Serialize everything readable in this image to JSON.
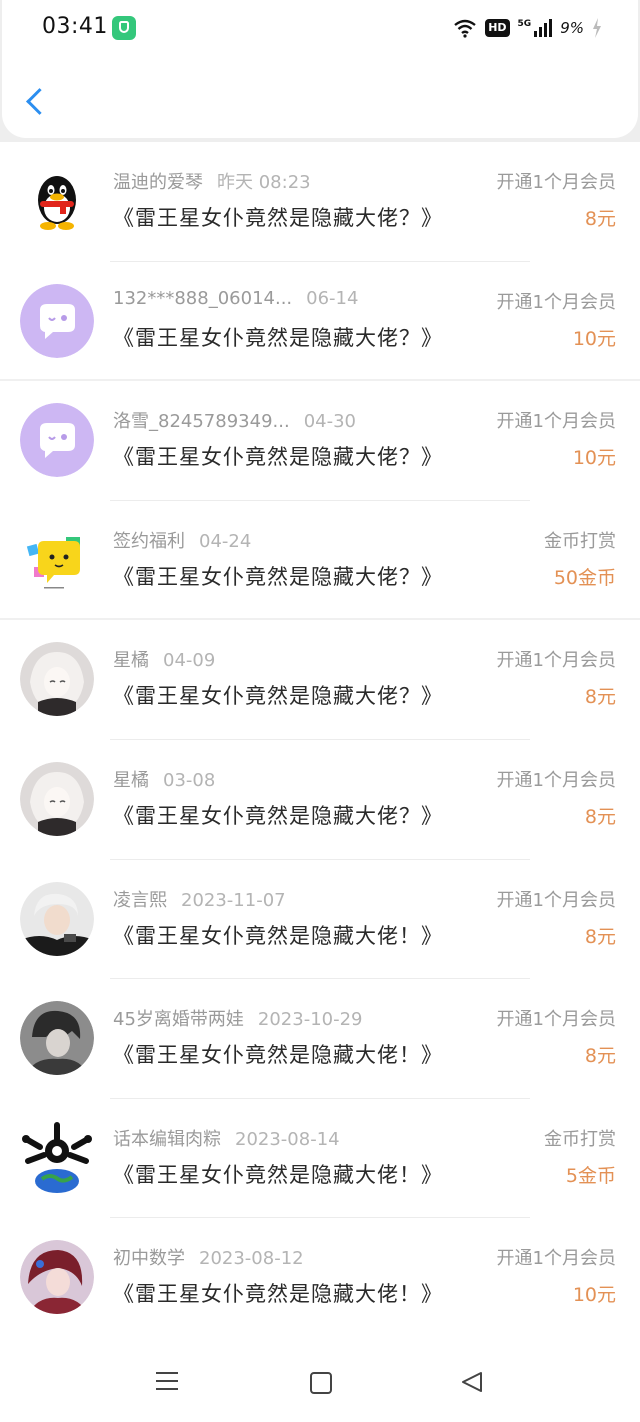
{
  "status_bar": {
    "time": "03:41",
    "hd_label": "HD",
    "network_label": "5G",
    "battery": "9%"
  },
  "header": {
    "back_icon": "chevron-left-icon",
    "accent": "#2b8ef0"
  },
  "colors": {
    "amount": "#e39155",
    "meta": "#9a9a9a",
    "title": "#2a2a2a"
  },
  "records": [
    {
      "name": "温迪的爱琴",
      "date": "昨天 08:23",
      "title": "《雷王星女仆竟然是隐藏大佬？》",
      "type": "开通1个月会员",
      "amount": "8元",
      "avatar": "qq-penguin-avatar"
    },
    {
      "name": "132***888_06014...",
      "date": "06-14",
      "title": "《雷王星女仆竟然是隐藏大佬？》",
      "type": "开通1个月会员",
      "amount": "10元",
      "avatar": "default-chat-avatar"
    },
    {
      "name": "洛雪_8245789349...",
      "date": "04-30",
      "title": "《雷王星女仆竟然是隐藏大佬？》",
      "type": "开通1个月会员",
      "amount": "10元",
      "avatar": "default-chat-avatar"
    },
    {
      "name": "签约福利",
      "date": "04-24",
      "title": "《雷王星女仆竟然是隐藏大佬？》",
      "type": "金币打赏",
      "amount": "50金币",
      "avatar": "yellow-chat-avatar"
    },
    {
      "name": "星橘",
      "date": "04-09",
      "title": "《雷王星女仆竟然是隐藏大佬？》",
      "type": "开通1个月会员",
      "amount": "8元",
      "avatar": "anime-girl-avatar"
    },
    {
      "name": "星橘",
      "date": "03-08",
      "title": "《雷王星女仆竟然是隐藏大佬？》",
      "type": "开通1个月会员",
      "amount": "8元",
      "avatar": "anime-girl-avatar"
    },
    {
      "name": "凌言熙",
      "date": "2023-11-07",
      "title": "《雷王星女仆竟然是隐藏大佬！》",
      "type": "开通1个月会员",
      "amount": "8元",
      "avatar": "photo-avatar"
    },
    {
      "name": "45岁离婚带两娃",
      "date": "2023-10-29",
      "title": "《雷王星女仆竟然是隐藏大佬！》",
      "type": "开通1个月会员",
      "amount": "8元",
      "avatar": "anime-boy-avatar"
    },
    {
      "name": "话本编辑肉粽",
      "date": "2023-08-14",
      "title": "《雷王星女仆竟然是隐藏大佬！》",
      "type": "金币打赏",
      "amount": "5金币",
      "avatar": "earth-avatar"
    },
    {
      "name": "初中数学",
      "date": "2023-08-12",
      "title": "《雷王星女仆竟然是隐藏大佬！》",
      "type": "开通1个月会员",
      "amount": "10元",
      "avatar": "anime-girl-red-avatar"
    }
  ],
  "nav": {
    "menu_icon": "menu-icon",
    "home_icon": "home-square-icon",
    "back_icon": "back-triangle-icon"
  }
}
